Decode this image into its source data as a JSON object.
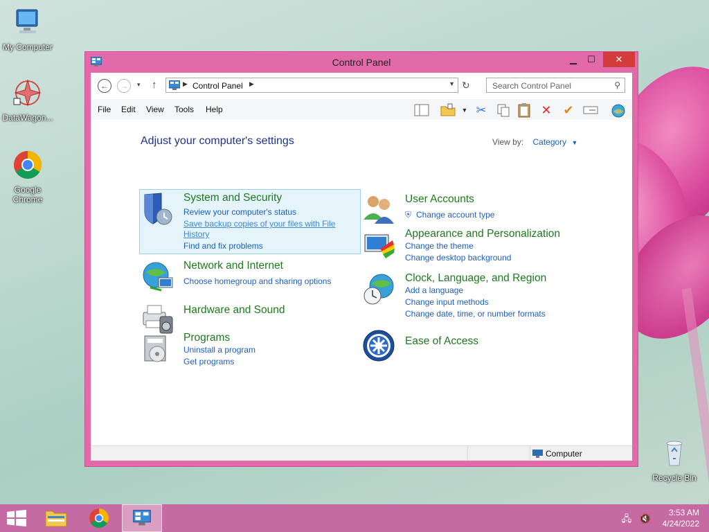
{
  "desktop": {
    "icons": [
      {
        "label": "My Computer"
      },
      {
        "label": "DataWagon..."
      },
      {
        "label": "Google Chrome"
      },
      {
        "label": "Recycle Bin"
      }
    ]
  },
  "window": {
    "title": "Control Panel",
    "caption": {
      "minimize": "▁",
      "maximize": "☐",
      "close": "✕"
    },
    "nav": {
      "back": "←",
      "forward": "→",
      "up": "↑",
      "dropdown": "▾"
    },
    "address": {
      "crumb": "Control Panel"
    },
    "search": {
      "placeholder": "Search Control Panel"
    },
    "menu": [
      "File",
      "Edit",
      "View",
      "Tools",
      "Help"
    ]
  },
  "content": {
    "heading": "Adjust your computer's settings",
    "view_by_label": "View by:",
    "view_by_value": "Category",
    "categories": [
      {
        "title": "System and Security",
        "links": [
          "Review your computer's status",
          "Save backup copies of your files with File",
          "History",
          "Find and fix problems"
        ]
      },
      {
        "title": "Network and Internet",
        "links": [
          "Choose homegroup and sharing options"
        ]
      },
      {
        "title": "Hardware and Sound",
        "links": []
      },
      {
        "title": "Programs",
        "links": [
          "Uninstall a program",
          "Get programs"
        ]
      },
      {
        "title": "User Accounts",
        "links": [
          "Change account type"
        ]
      },
      {
        "title": "Appearance and Personalization",
        "links": [
          "Change the theme",
          "Change desktop background"
        ]
      },
      {
        "title": "Clock, Language, and Region",
        "links": [
          "Add a language",
          "Change input methods",
          "Change date, time, or number formats"
        ]
      },
      {
        "title": "Ease of Access",
        "links": []
      }
    ]
  },
  "statusbar": {
    "location": "Computer"
  },
  "taskbar": {
    "time": "3:53 AM",
    "date": "4/24/2022"
  },
  "colors": {
    "window_frame": "#e26aa8",
    "taskbar": "#c66aa3",
    "category_title": "#1e7a1e",
    "link": "#1e5fbf",
    "heading": "#1e3287"
  }
}
